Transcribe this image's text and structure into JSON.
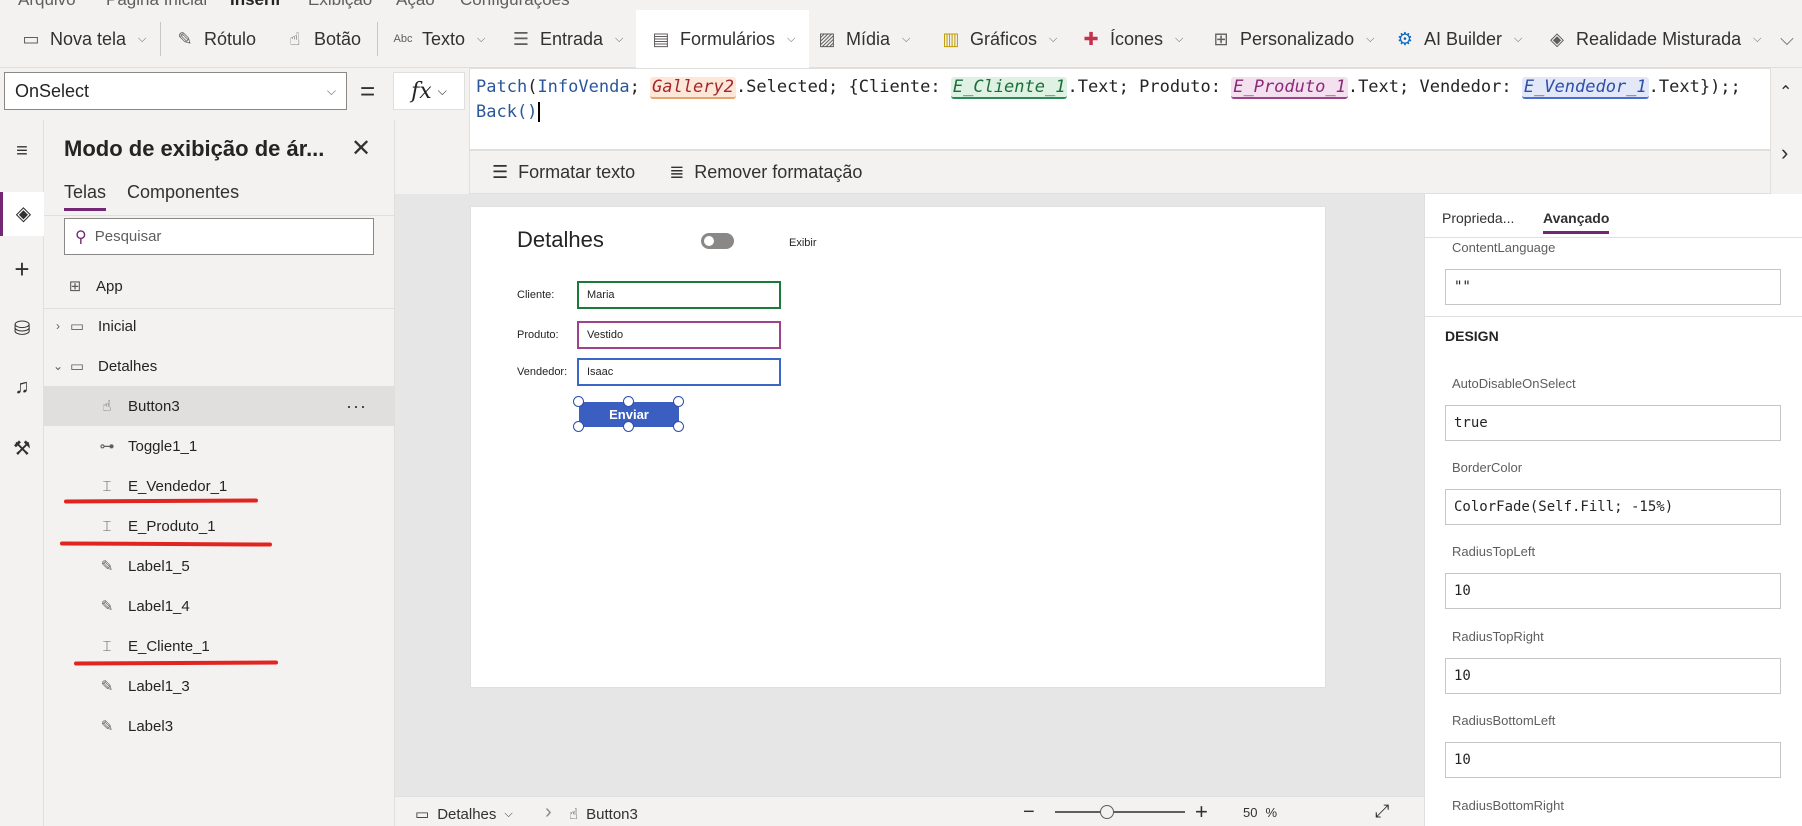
{
  "menu": {
    "items": [
      "Arquivo",
      "Página Inicial",
      "Inserir",
      "Exibição",
      "Ação",
      "Configurações"
    ]
  },
  "ribbon": {
    "nova_tela": "Nova tela",
    "rotulo": "Rótulo",
    "botao": "Botão",
    "texto": "Texto",
    "entrada": "Entrada",
    "formularios": "Formulários",
    "midia": "Mídia",
    "graficos": "Gráficos",
    "icones": "Ícones",
    "personalizado": "Personalizado",
    "ai_builder": "AI Builder",
    "realidade": "Realidade Misturada"
  },
  "formula_bar": {
    "property": "OnSelect",
    "equals": "=",
    "fx": "fx",
    "line1": {
      "patch": "Patch",
      "infovenda": "InfoVenda",
      "sep1": "; ",
      "gallery": "Gallery2",
      "selected": ".Selected; {Cliente: ",
      "cliente_ctrl": "E_Cliente_1",
      "text1": ".Text; Produto: ",
      "produto_ctrl": "E_Produto_1",
      "text2": ".Text; Vendedor: ",
      "vendedor_ctrl": "E_Vendedor_1",
      "text3": ".Text});;"
    },
    "line2": "Back()",
    "format_text": "Formatar texto",
    "remove_format": "Remover formatação"
  },
  "tree": {
    "title": "Modo de exibição de ár...",
    "tabs": {
      "telas": "Telas",
      "componentes": "Componentes"
    },
    "search_placeholder": "Pesquisar",
    "items": {
      "app": "App",
      "inicial": "Inicial",
      "detalhes": "Detalhes",
      "button3": "Button3",
      "toggle": "Toggle1_1",
      "e_vendedor": "E_Vendedor_1",
      "e_produto": "E_Produto_1",
      "label1_5": "Label1_5",
      "label1_4": "Label1_4",
      "e_cliente": "E_Cliente_1",
      "label1_3": "Label1_3",
      "label3": "Label3"
    }
  },
  "screen": {
    "title": "Detalhes",
    "toggle_label": "Exibir",
    "cliente_label": "Cliente:",
    "cliente_value": "Maria",
    "produto_label": "Produto:",
    "produto_value": "Vestido",
    "vendedor_label": "Vendedor:",
    "vendedor_value": "Isaac",
    "button": "Enviar"
  },
  "statusbar": {
    "screen": "Detalhes",
    "control": "Button3",
    "zoom": "50",
    "zoom_unit": "%"
  },
  "props": {
    "tabs": {
      "propriedades": "Proprieda...",
      "avancado": "Avançado"
    },
    "content_language_label": "ContentLanguage",
    "content_language_value": "\"\"",
    "design": "DESIGN",
    "auto_disable_label": "AutoDisableOnSelect",
    "auto_disable_value": "true",
    "border_color_label": "BorderColor",
    "border_color_value": "ColorFade(Self.Fill; -15%)",
    "radius_top_left_label": "RadiusTopLeft",
    "radius_top_left_value": "10",
    "radius_top_right_label": "RadiusTopRight",
    "radius_top_right_value": "10",
    "radius_bottom_left_label": "RadiusBottomLeft",
    "radius_bottom_left_value": "10",
    "radius_bottom_right_label": "RadiusBottomRight"
  },
  "colors": {
    "accent": "#742774",
    "button": "#3a5fc0",
    "cliente_border": "#1b7a3a",
    "produto_border": "#a0418c",
    "vendedor_border": "#3a66c8",
    "annotation_red": "#e0241f"
  }
}
